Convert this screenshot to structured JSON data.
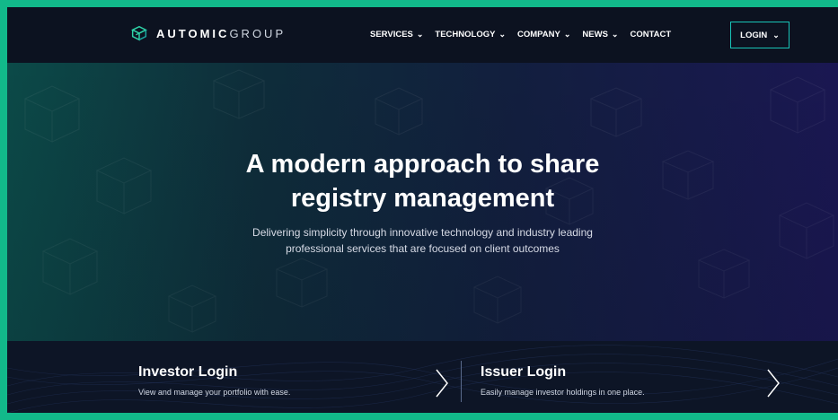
{
  "brand": {
    "bold": "AUTOMIC",
    "light": "GROUP",
    "logo_icon": "cube-logo-icon"
  },
  "nav": {
    "items": [
      {
        "label": "SERVICES",
        "dropdown": true
      },
      {
        "label": "TECHNOLOGY",
        "dropdown": true
      },
      {
        "label": "COMPANY",
        "dropdown": true
      },
      {
        "label": "NEWS",
        "dropdown": true
      },
      {
        "label": "CONTACT",
        "dropdown": false
      }
    ],
    "login_label": "LOGIN"
  },
  "hero": {
    "title_line1": "A modern approach to share",
    "title_line2": "registry management",
    "subtitle_line1": "Delivering simplicity through innovative technology and industry leading",
    "subtitle_line2": "professional services that are focused on client outcomes"
  },
  "cards": {
    "investor": {
      "title": "Investor Login",
      "desc": "View and manage your portfolio with ease."
    },
    "issuer": {
      "title": "Issuer Login",
      "desc": "Easily manage investor holdings in one place."
    }
  },
  "colors": {
    "accent": "#18c4b8",
    "frame": "#12b98a",
    "nav_bg": "#0c1220"
  }
}
